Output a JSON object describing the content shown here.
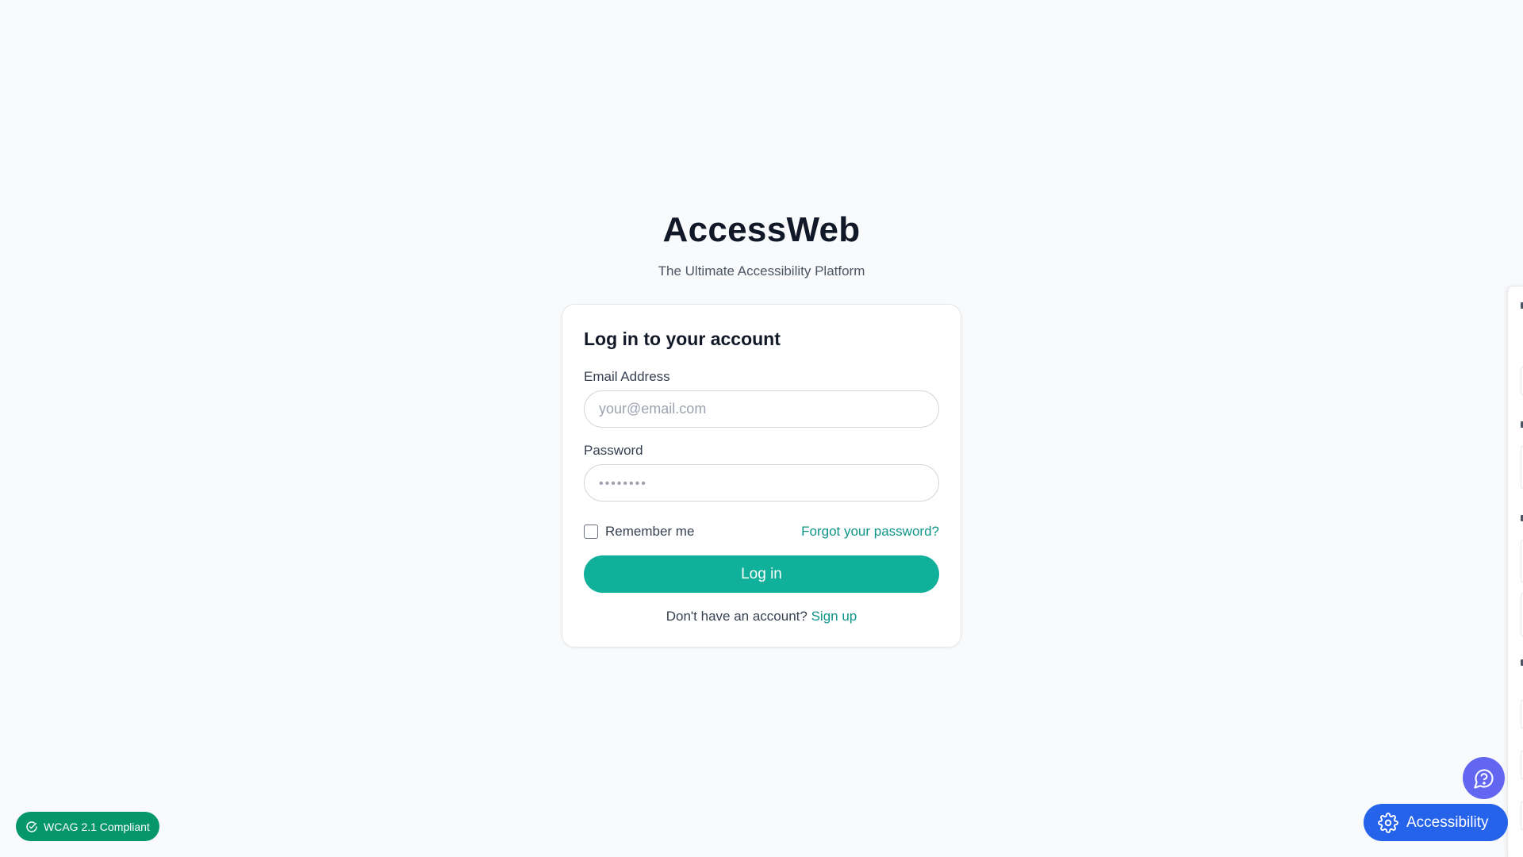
{
  "brand": {
    "title": "AccessWeb",
    "subtitle": "The Ultimate Accessibility Platform"
  },
  "login": {
    "heading": "Log in to your account",
    "email_label": "Email Address",
    "email_placeholder": "your@email.com",
    "email_value": "",
    "password_label": "Password",
    "password_placeholder": "••••••••",
    "password_value": "",
    "remember_label": "Remember me",
    "remember_checked": false,
    "forgot_label": "Forgot your password?",
    "submit_label": "Log in",
    "signup_prompt": "Don't have an account?",
    "signup_label": "Sign up"
  },
  "badge": {
    "label": "WCAG 2.1 Compliant",
    "icon": "check-circle-icon"
  },
  "floating": {
    "help_icon": "chat-help-icon",
    "accessibility_label": "Accessibility",
    "accessibility_icon": "gear-icon"
  },
  "colors": {
    "accent": "#10b09a",
    "link": "#0d9488",
    "badge": "#059669",
    "help_button": "#6366f1",
    "accessibility_button": "#2563eb",
    "background": "#f8fafc"
  }
}
